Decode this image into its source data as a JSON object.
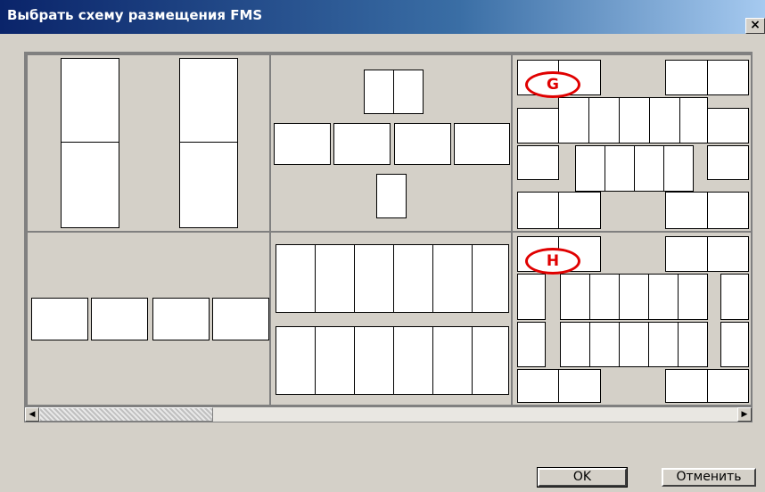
{
  "window": {
    "title": "Выбрать схему размещения FMS",
    "close_label": "×"
  },
  "layouts": {
    "g_label": "G",
    "h_label": "H"
  },
  "scrollbar": {
    "left_arrow": "◀",
    "right_arrow": "▶",
    "thumb_position_fraction": 0.0
  },
  "buttons": {
    "ok_label": "OK",
    "cancel_label": "Отменить"
  }
}
